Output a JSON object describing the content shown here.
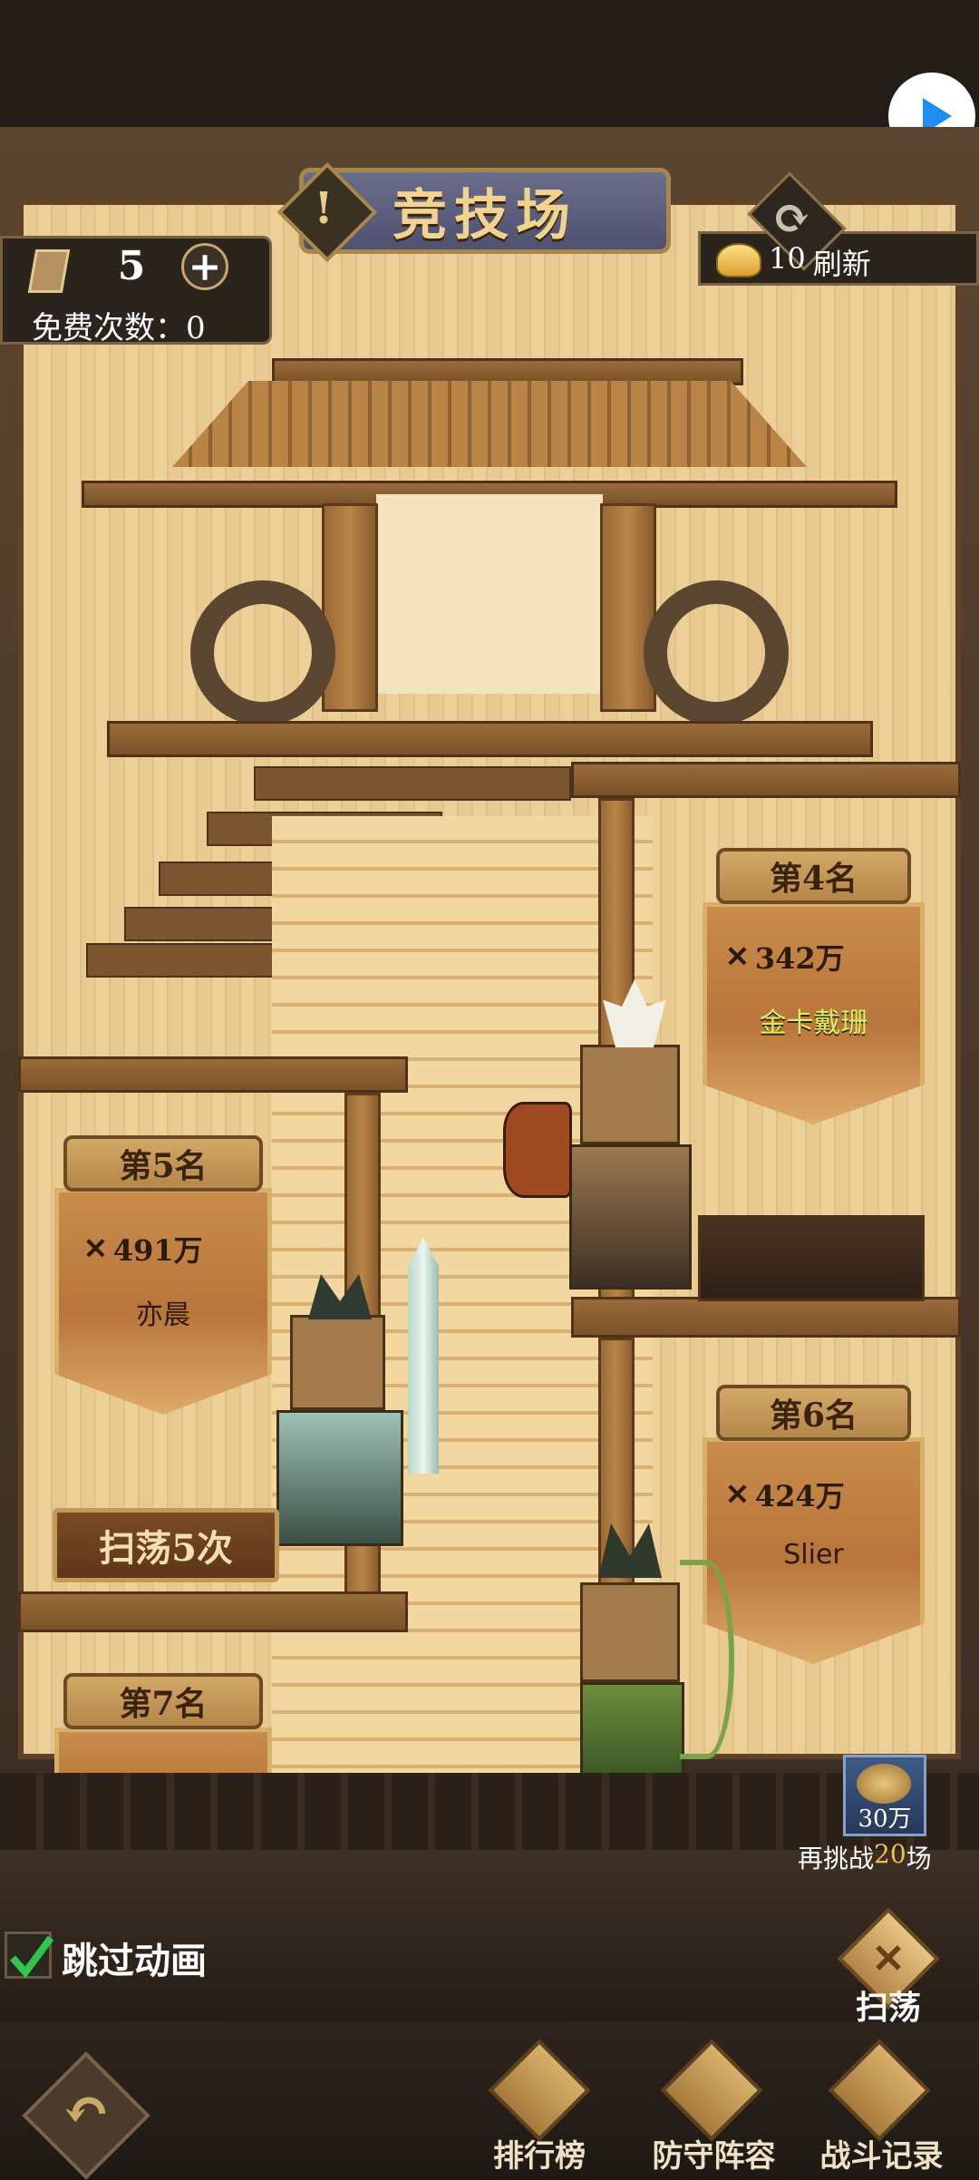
{
  "header": {
    "title": "竞技场",
    "warn_symbol": "!"
  },
  "tickets": {
    "count": "5",
    "plus": "+",
    "free_label": "免费次数：0"
  },
  "refresh": {
    "cost": "10",
    "label": "刷新"
  },
  "opponents": [
    {
      "rank": "第4名",
      "power": "342万",
      "name": "金卡戴珊"
    },
    {
      "rank": "第5名",
      "power": "491万",
      "name": "亦晨"
    },
    {
      "rank": "第6名",
      "power": "424万",
      "name": "Slier"
    },
    {
      "rank": "第7名",
      "power": "",
      "name": ""
    }
  ],
  "sweep_5": {
    "label": "扫荡5次"
  },
  "bonus": {
    "reward": "30万",
    "text_prefix": "再挑战",
    "count": "20",
    "text_suffix": "场"
  },
  "skip_anim": {
    "label": "跳过动画",
    "checked": true
  },
  "sweep_button": {
    "label": "扫荡"
  },
  "nav": {
    "ranking": "排行榜",
    "defense": "防守阵容",
    "battle_log": "战斗记录"
  },
  "colors": {
    "gold": "#f1d28e",
    "banner": "#c98c4c",
    "highlight_count": "#f4c04a",
    "name_green": "#d6f060"
  }
}
